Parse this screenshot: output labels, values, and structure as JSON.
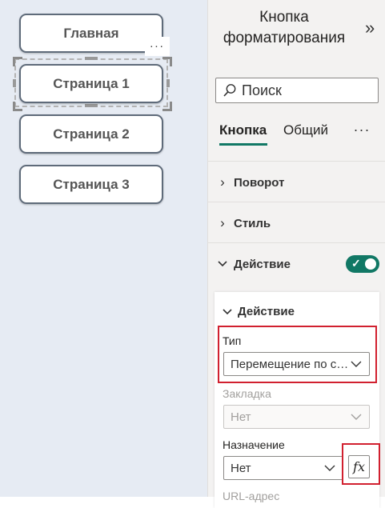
{
  "canvas": {
    "buttons": [
      "Главная",
      "Страница 1",
      "Страница 2",
      "Страница 3"
    ],
    "more_label": "..."
  },
  "pane": {
    "title_line1": "Кнопка",
    "title_line2": "форматирования",
    "collapse_icon": "double-chevron-right",
    "search_placeholder": "Поиск",
    "tabs": [
      "Кнопка",
      "Общий"
    ],
    "tab_more": "...",
    "sections": [
      "Поворот",
      "Стиль",
      "Действие"
    ],
    "action_toggle": true,
    "action_card": {
      "title": "Действие",
      "type_label": "Тип",
      "type_value": "Перемещение по ст...",
      "bookmark_label": "Закладка",
      "bookmark_value": "Нет",
      "destination_label": "Назначение",
      "destination_value": "Нет",
      "fx_label": "fx",
      "next_label_partial": "URL-адрес"
    }
  },
  "colors": {
    "accent": "#117865",
    "highlight": "#d1202f"
  }
}
